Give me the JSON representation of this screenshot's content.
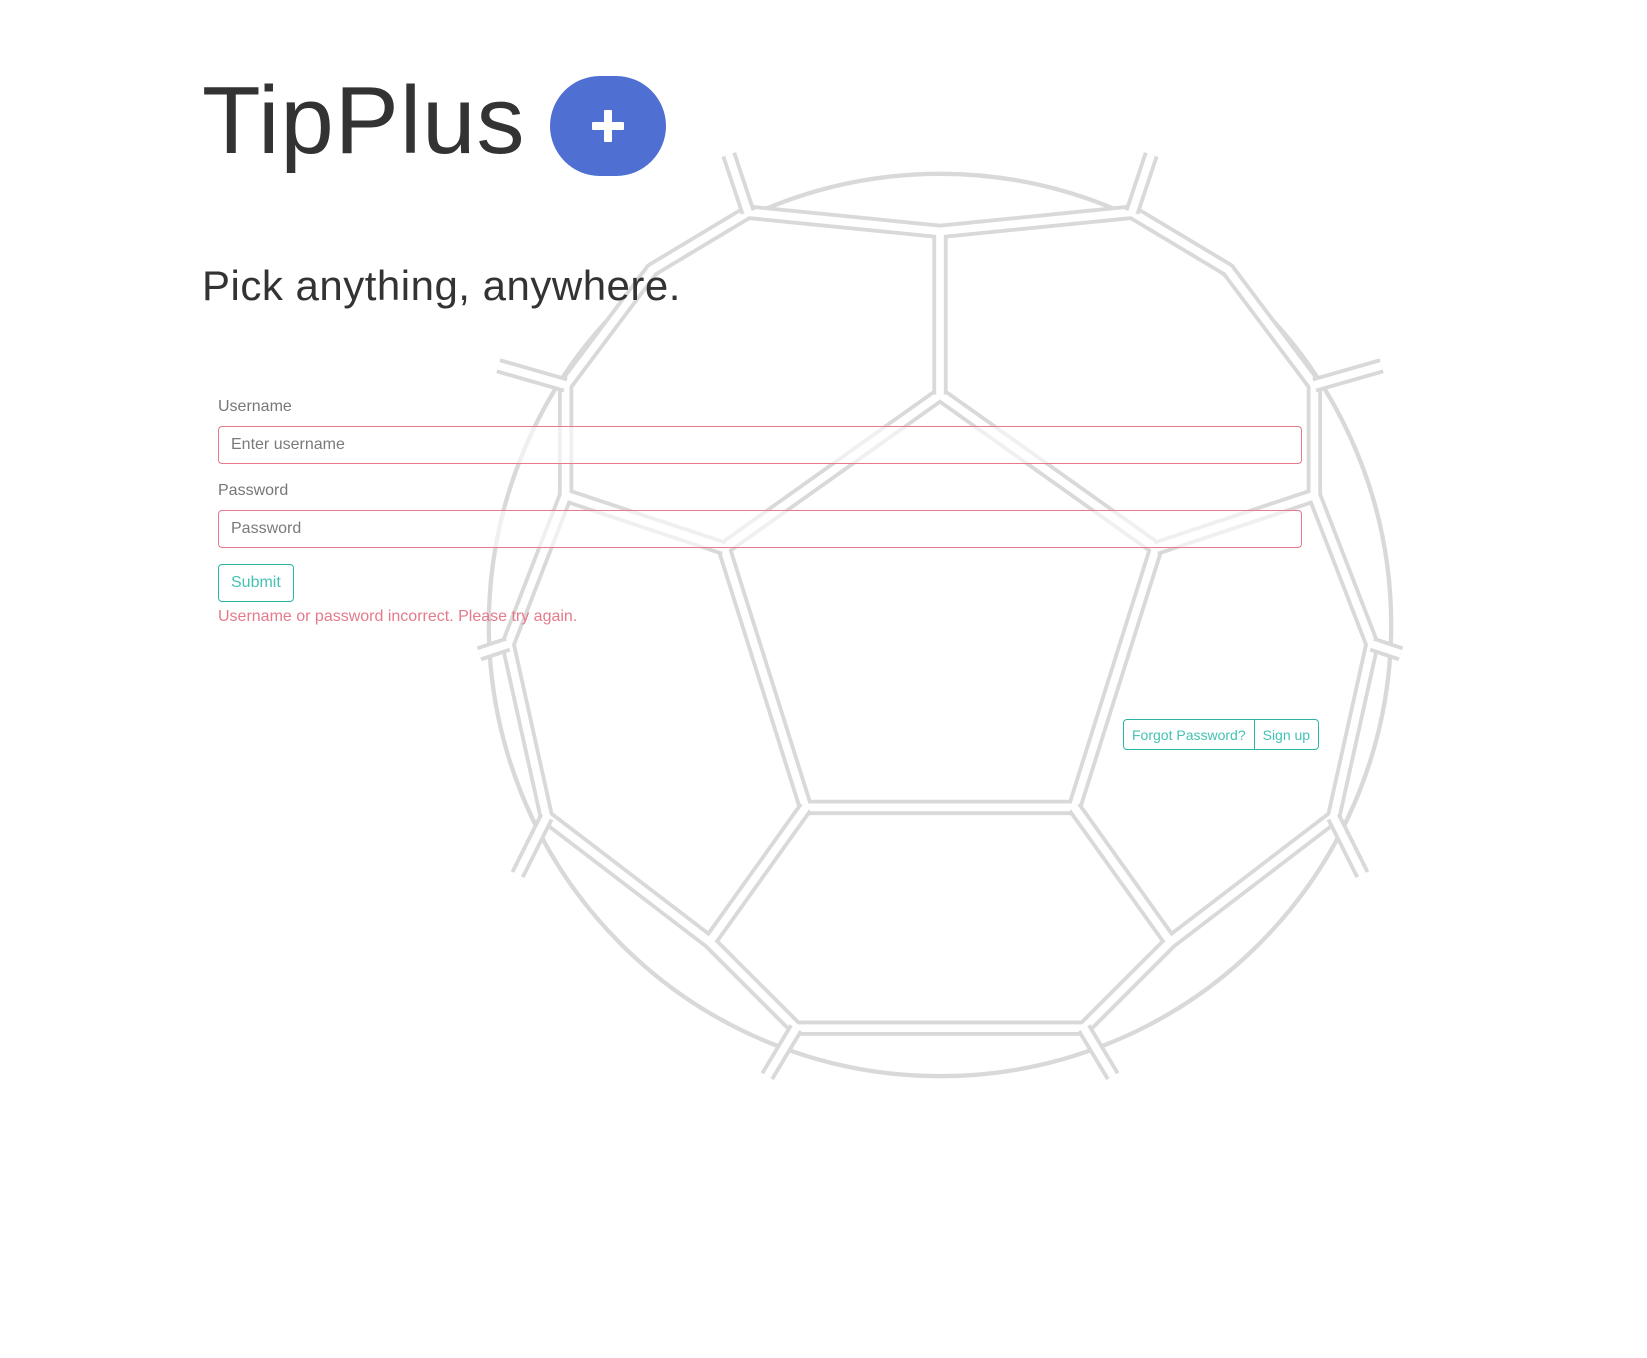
{
  "brand": {
    "title": "TipPlus",
    "badge_icon": "plus-icon",
    "badge_color": "#4f6fd3"
  },
  "tagline": "Pick anything, anywhere.",
  "form": {
    "username_label": "Username",
    "username_placeholder": "Enter username",
    "username_value": "",
    "password_label": "Password",
    "password_placeholder": "Password",
    "password_value": "",
    "submit_label": "Submit",
    "error_message": "Username or password incorrect. Please try again.",
    "error_color": "#e57a8a",
    "accent_color": "#2ab5a5"
  },
  "links": {
    "forgot_password": "Forgot Password?",
    "sign_up": "Sign up"
  },
  "background": {
    "icon": "soccer-ball-icon"
  }
}
